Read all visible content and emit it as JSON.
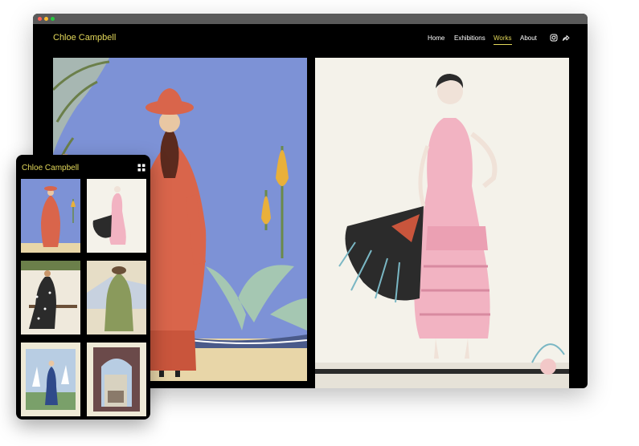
{
  "desktop": {
    "brand": "Chloe Campbell",
    "nav": [
      {
        "label": "Home",
        "active": false
      },
      {
        "label": "Exhibitions",
        "active": false
      },
      {
        "label": "Works",
        "active": true
      },
      {
        "label": "About",
        "active": false
      }
    ],
    "icons": [
      "instagram-icon",
      "share-icon"
    ]
  },
  "mobile": {
    "brand": "Chloe Campbell",
    "menu_icon": "grid-menu-icon"
  },
  "colors": {
    "accent": "#e3d85a",
    "background": "#000000",
    "sky": "#7d92d6",
    "coat": "#d9654b",
    "dress": "#f2b3c2"
  }
}
